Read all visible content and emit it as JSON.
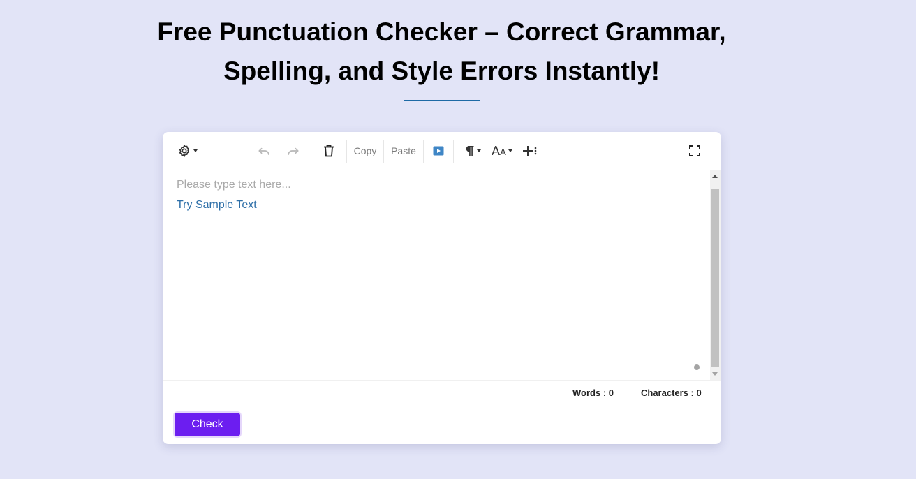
{
  "header": {
    "title_line1": "Free Punctuation Checker – Correct Grammar,",
    "title_line2": "Spelling, and Style Errors Instantly!"
  },
  "toolbar": {
    "copy_label": "Copy",
    "paste_label": "Paste",
    "icons": [
      "gear-icon",
      "undo-icon",
      "redo-icon",
      "trash-icon",
      "play-icon",
      "paragraph-icon",
      "font-size-icon",
      "insert-icon",
      "fullscreen-icon"
    ]
  },
  "editor": {
    "placeholder": "Please type text here...",
    "sample_link": "Try Sample Text"
  },
  "stats": {
    "words_label": "Words : 0",
    "characters_label": "Characters : 0"
  },
  "actions": {
    "check_label": "Check"
  },
  "colors": {
    "background": "#e2e4f7",
    "accent_purple": "#6c1ef0",
    "divider_blue": "#1d6aa5",
    "link_blue": "#2e6fa8",
    "play_blue": "#3f86c6"
  }
}
